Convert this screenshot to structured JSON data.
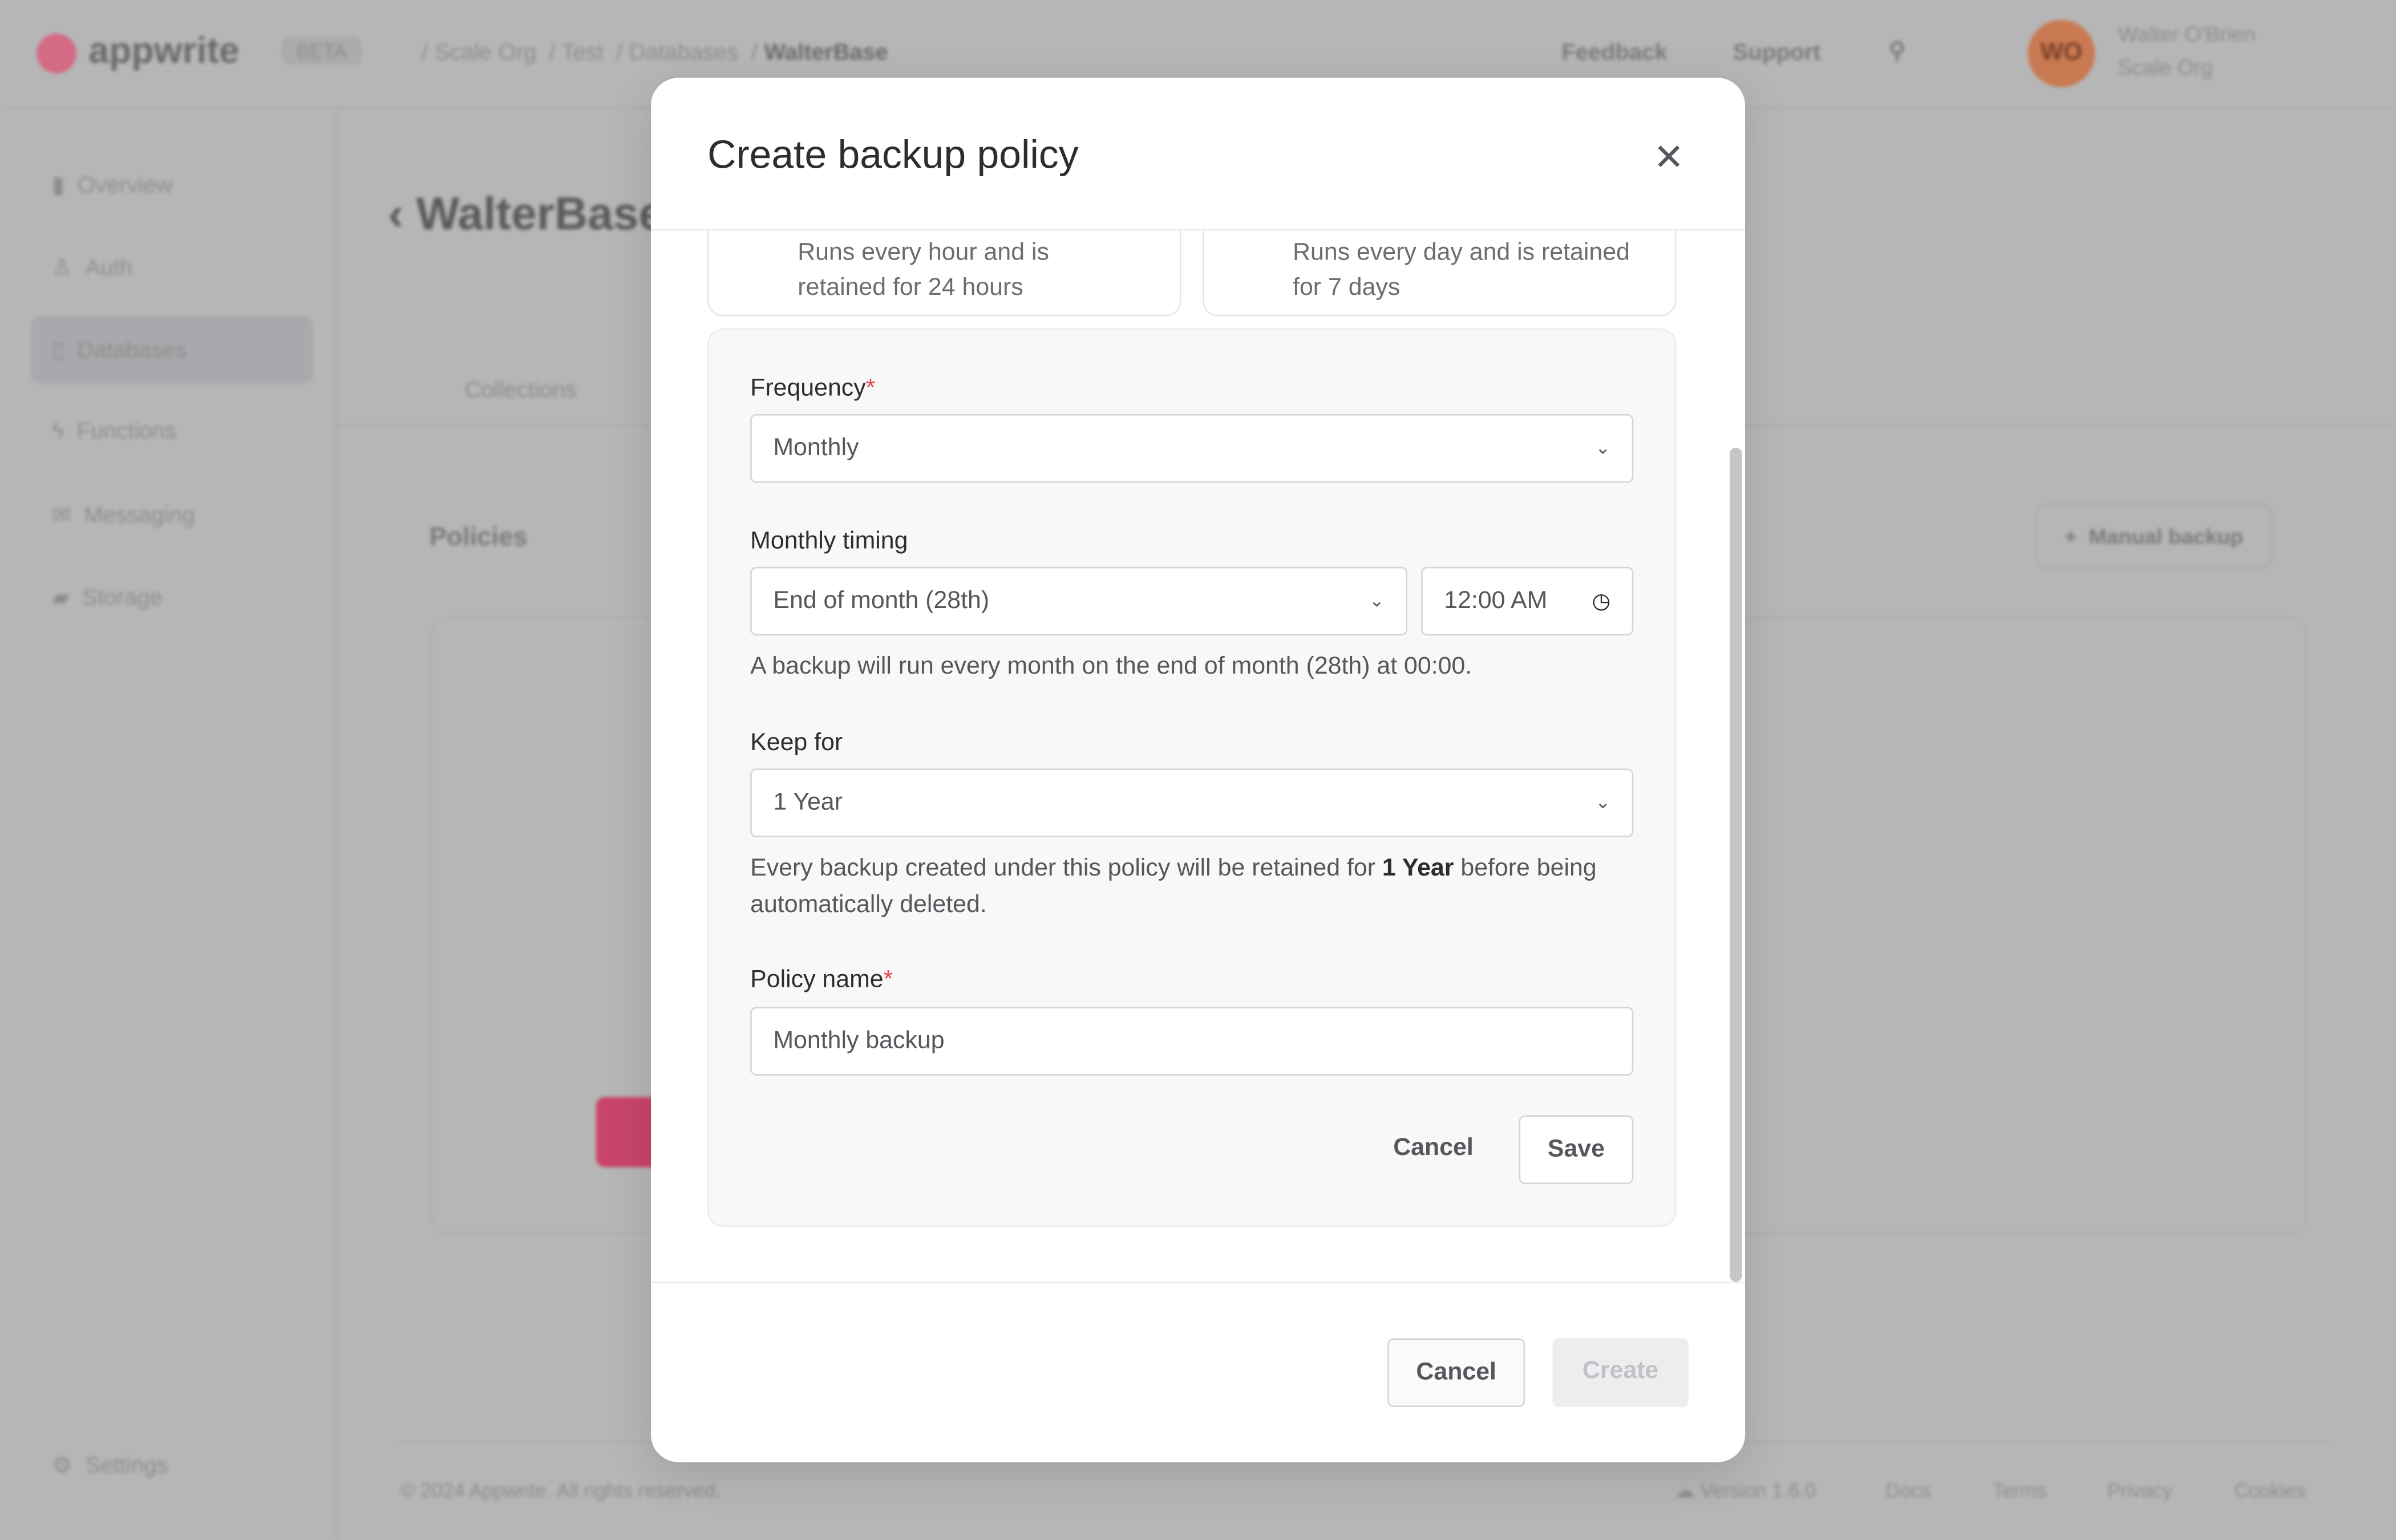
{
  "topbar": {
    "logo": "appwrite",
    "badge": "BETA",
    "breadcrumb": [
      "Scale Org",
      "Test",
      "Databases",
      "WalterBase"
    ],
    "feedback": "Feedback",
    "support": "Support",
    "avatar_initials": "WO",
    "user_name": "Walter O'Brien",
    "user_org": "Scale Org"
  },
  "sidebar": {
    "items": [
      {
        "label": "Overview"
      },
      {
        "label": "Auth"
      },
      {
        "label": "Databases"
      },
      {
        "label": "Functions"
      },
      {
        "label": "Messaging"
      },
      {
        "label": "Storage"
      }
    ],
    "settings": "Settings"
  },
  "page": {
    "title": "WalterBase",
    "tab": "Collections",
    "section": "Policies",
    "manual_backup": "Manual backup"
  },
  "footer": {
    "copyright": "© 2024 Appwrite. All rights reserved.",
    "version": "Version 1.6.0",
    "links": [
      "Docs",
      "Terms",
      "Privacy",
      "Cookies"
    ]
  },
  "modal": {
    "title": "Create backup policy",
    "cards": [
      {
        "line1": "Runs every hour and is",
        "line2": "retained for 24 hours"
      },
      {
        "line1": "Runs every day and is retained",
        "line2": "for 7 days"
      }
    ],
    "frequency": {
      "label": "Frequency",
      "required": "*",
      "value": "Monthly"
    },
    "timing": {
      "label": "Monthly timing",
      "value": "End of month (28th)",
      "time": "12:00 AM",
      "help": "A backup will run every month on the end of month (28th) at 00:00."
    },
    "keep": {
      "label": "Keep for",
      "value": "1 Year",
      "help_pre": "Every backup created under this policy will be retained for ",
      "help_bold": "1 Year",
      "help_post": " before being automatically deleted."
    },
    "policy_name": {
      "label": "Policy name",
      "required": "*",
      "value": "Monthly backup"
    },
    "panel_cancel": "Cancel",
    "panel_save": "Save",
    "cancel": "Cancel",
    "create": "Create"
  },
  "colors": {
    "accent": "#fd366e",
    "avatar": "#c97a52",
    "required": "#e5484d"
  }
}
